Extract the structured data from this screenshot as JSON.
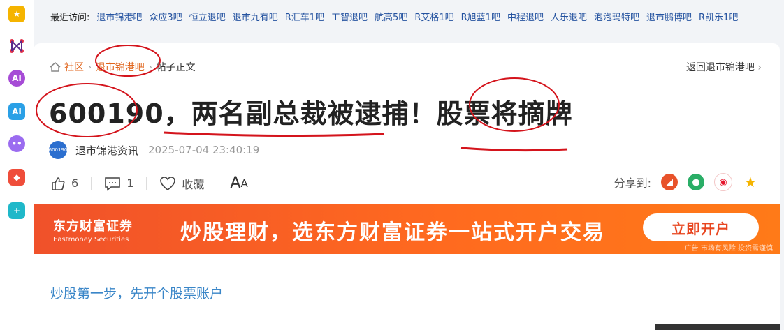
{
  "topbar": {
    "label": "最近访问:",
    "links": [
      "退市锦港吧",
      "众应3吧",
      "恒立退吧",
      "退市九有吧",
      "R汇车1吧",
      "工智退吧",
      "航高5吧",
      "R艾格1吧",
      "R旭蓝1吧",
      "中程退吧",
      "人乐退吧",
      "泡泡玛特吧",
      "退市鹏博吧",
      "R凯乐1吧"
    ]
  },
  "breadcrumb": {
    "home": "社区",
    "bar": "退市锦港吧",
    "current": "帖子正文"
  },
  "back_link": "返回退市锦港吧",
  "post": {
    "title": "600190，两名副总裁被逮捕！股票将摘牌",
    "avatar_text": "600190",
    "author": "退市锦港资讯",
    "time": "2025-07-04 23:40:19"
  },
  "actions": {
    "likes": "6",
    "comments": "1",
    "favorite": "收藏",
    "fontsize_big": "A",
    "fontsize_small": "A"
  },
  "share": {
    "label": "分享到:"
  },
  "banner": {
    "brand_name": "东方财富证券",
    "brand_en": "Eastmoney Securities",
    "slogan": "炒股理财，选东方财富证券一站式开户交易",
    "cta": "立即开户",
    "disclaimer": "广告 市场有风险 投资需谨慎"
  },
  "body": {
    "link_text": "炒股第一步，先开个股票账户"
  },
  "colors": {
    "accent": "#e0651c",
    "link": "#3a86c8",
    "banner": "#f0512a"
  }
}
